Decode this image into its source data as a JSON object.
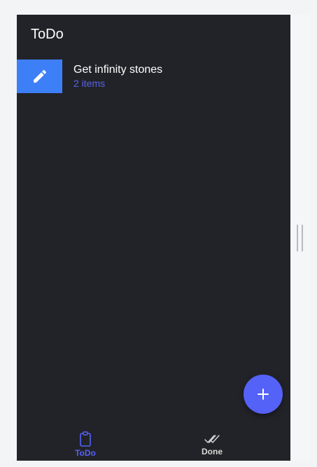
{
  "app": {
    "title": "ToDo"
  },
  "todo_items": [
    {
      "title": "Get infinity stones",
      "count_text": "2 items"
    }
  ],
  "bottom_nav": {
    "tabs": [
      {
        "label": "ToDo",
        "icon": "clipboard-icon",
        "active": true
      },
      {
        "label": "Done",
        "icon": "double-check-icon",
        "active": false
      }
    ]
  },
  "colors": {
    "background": "#222328",
    "accent": "#5462f7",
    "edit_box": "#3d7ff6",
    "count_text": "#5a62ee"
  }
}
